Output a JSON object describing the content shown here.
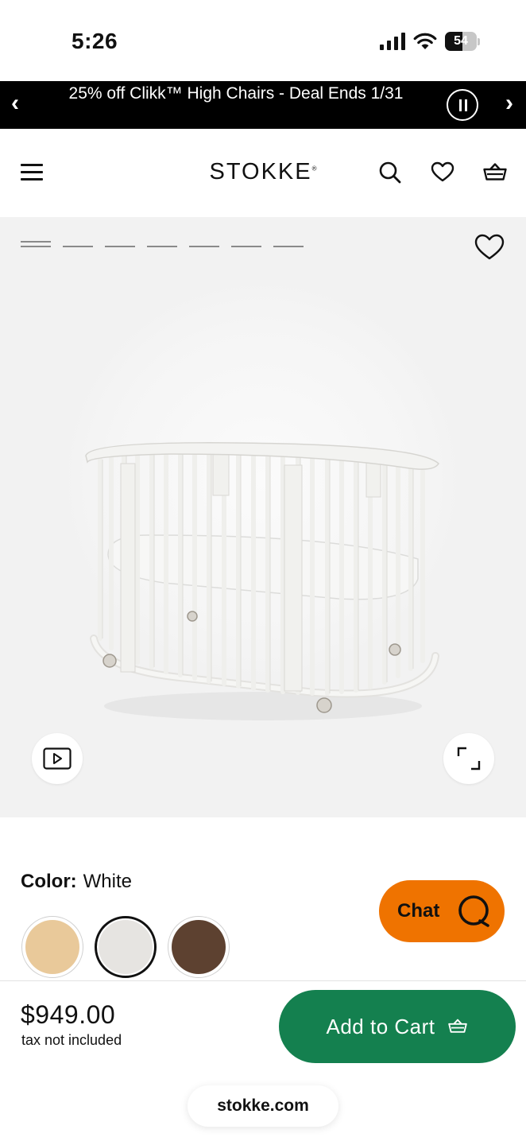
{
  "status_bar": {
    "time": "5:26",
    "battery": "54",
    "battery_level": 0.54
  },
  "promo": {
    "prev_glyph": "‹",
    "next_glyph": "›",
    "text": "25% off Clikk™ High Chairs - Deal Ends 1/31"
  },
  "header": {
    "logo": "STOKKE",
    "logo_mark": "®"
  },
  "gallery": {
    "image_count": 7,
    "active_index": 0
  },
  "product": {
    "color_label": "Color:",
    "color_value": "White",
    "swatches": [
      {
        "name": "Natural",
        "color": "#e9c99a",
        "selected": false
      },
      {
        "name": "White",
        "color": "#e6e4e1",
        "selected": true
      },
      {
        "name": "Walnut",
        "color": "#5d4130",
        "selected": false
      }
    ],
    "price": "$949.00",
    "tax_note": "tax not included",
    "add_to_cart": "Add to Cart"
  },
  "chat": {
    "label": "Chat"
  },
  "browser": {
    "url": "stokke.com"
  },
  "colors": {
    "cart_green": "#14804f",
    "chat_orange": "#ef7300",
    "promo_bg": "#000000"
  }
}
